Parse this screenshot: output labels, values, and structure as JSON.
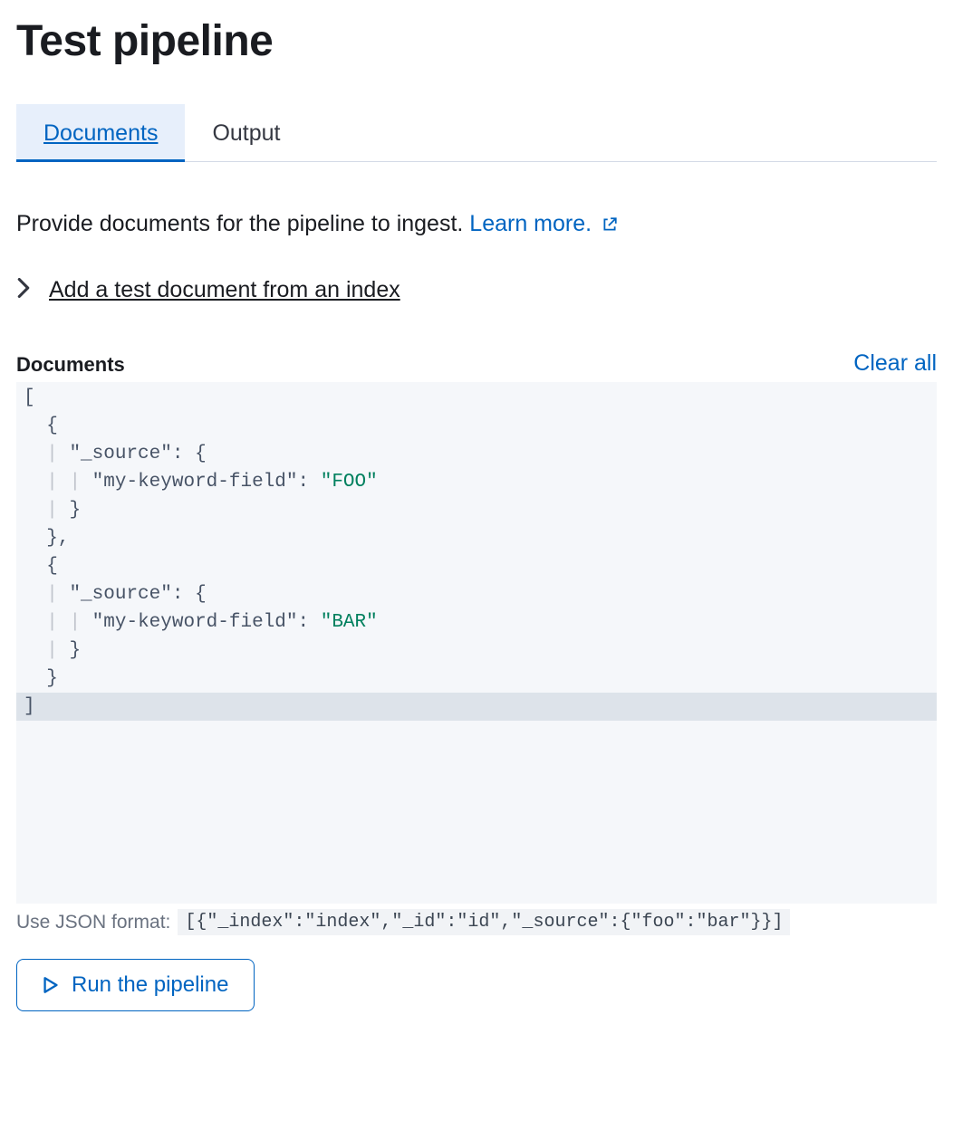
{
  "title": "Test pipeline",
  "tabs": [
    {
      "label": "Documents",
      "active": true
    },
    {
      "label": "Output",
      "active": false
    }
  ],
  "intro": {
    "text": "Provide documents for the pipeline to ingest. ",
    "learn_more": "Learn more."
  },
  "add_from_index": "Add a test document from an index",
  "documents_section": {
    "label": "Documents",
    "clear_all": "Clear all"
  },
  "editor": {
    "documents": [
      {
        "_source": {
          "my-keyword-field": "FOO"
        }
      },
      {
        "_source": {
          "my-keyword-field": "BAR"
        }
      }
    ]
  },
  "hint": {
    "label": "Use JSON format:",
    "example": "[{\"_index\":\"index\",\"_id\":\"id\",\"_source\":{\"foo\":\"bar\"}}]"
  },
  "run_button": "Run the pipeline"
}
